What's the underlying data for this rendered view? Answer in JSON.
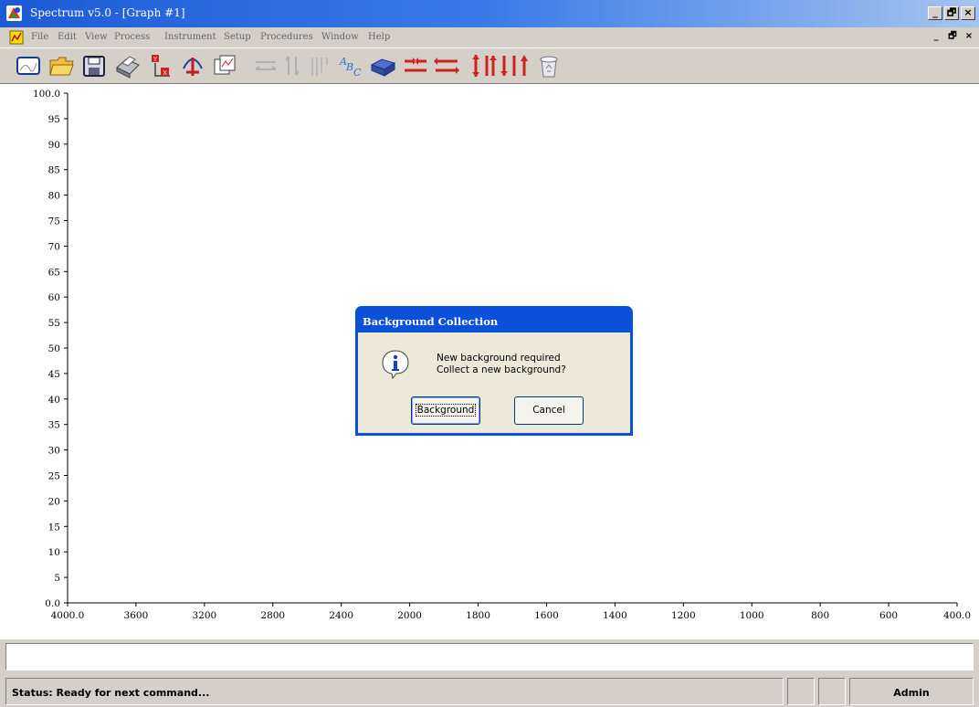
{
  "window": {
    "title": "Spectrum v5.0 - [Graph #1]",
    "controls": {
      "minimize": "_",
      "restore": "🗗",
      "close": "×"
    }
  },
  "menu": {
    "items": [
      "File",
      "Edit",
      "View",
      "Process",
      "Instrument",
      "Setup",
      "Procedures",
      "Window",
      "Help"
    ]
  },
  "toolbar": {
    "icons": [
      "new-graph-icon",
      "open-folder-icon",
      "save-disk-icon",
      "print-icon",
      "cursor-x-icon",
      "cursor-peak-icon",
      "overlay-icon",
      "expand-horizontal-icon",
      "expand-vertical-icon",
      "peak-label-icon",
      "text-label-icon",
      "scan-instrument-icon",
      "shrink-horizontal-icon",
      "expand-horizontal-red-icon",
      "scale-vertical-icon",
      "offset-vertical-icon",
      "arrow-up-icon",
      "recycle-bin-icon"
    ]
  },
  "chart_data": {
    "type": "line",
    "y_ticks": [
      "100.0",
      "95",
      "90",
      "85",
      "80",
      "75",
      "70",
      "65",
      "60",
      "55",
      "50",
      "45",
      "40",
      "35",
      "30",
      "25",
      "20",
      "15",
      "10",
      "5",
      "0.0"
    ],
    "x_ticks": [
      "4000.0",
      "3600",
      "3200",
      "2800",
      "2400",
      "2000",
      "1800",
      "1600",
      "1400",
      "1200",
      "1000",
      "800",
      "600",
      "400.0"
    ],
    "ylim": [
      0,
      100
    ],
    "xlim": [
      4000,
      400
    ],
    "series": []
  },
  "dialog": {
    "title": "Background Collection",
    "message_line1": "New background required",
    "message_line2": "Collect a new background?",
    "primary_button": "Background",
    "cancel_button": "Cancel"
  },
  "statusbar": {
    "status": "Status: Ready for next command...",
    "user": "Admin"
  }
}
